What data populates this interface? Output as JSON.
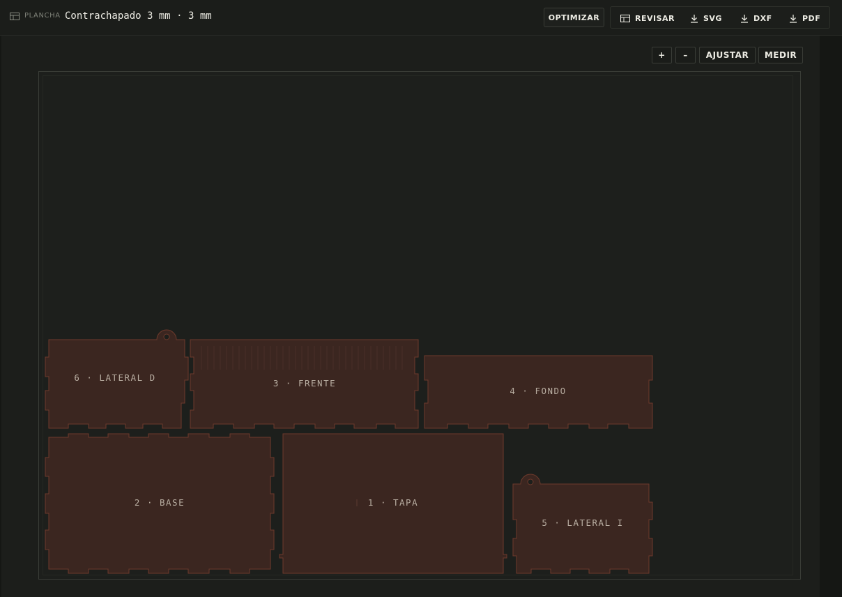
{
  "toolbar": {
    "sheet_label": "PLANCHA",
    "sheet_material": "Contrachapado 3 mm · 3 mm",
    "optimize_label": "OPTIMIZAR",
    "review_label": "REVISAR",
    "svg_label": "SVG",
    "dxf_label": "DXF",
    "pdf_label": "PDF"
  },
  "zoom": {
    "zoom_in": "+",
    "zoom_out": "–",
    "fit_label": "AJUSTAR",
    "measure_label": "MEDIR"
  },
  "pieces": [
    {
      "name": "lateral-d",
      "label": "6 · LATERAL D"
    },
    {
      "name": "frente",
      "label": "3 · FRENTE"
    },
    {
      "name": "fondo",
      "label": "4 · FONDO"
    },
    {
      "name": "base",
      "label": "2 · BASE"
    },
    {
      "name": "tapa",
      "label": "1 · TAPA"
    },
    {
      "name": "lateral-i",
      "label": "5 · LATERAL I"
    }
  ],
  "colors": {
    "piece_fill": "#3b2620",
    "piece_stroke": "#6e3a2c",
    "board_stroke": "#3a3d37",
    "accent": "#ecebe3"
  }
}
